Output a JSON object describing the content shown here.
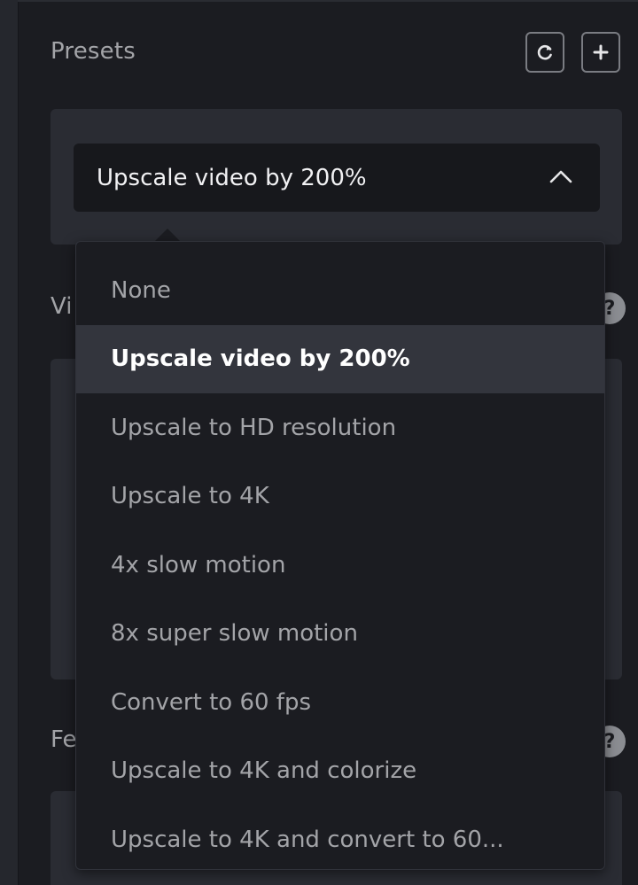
{
  "presets": {
    "title": "Presets",
    "refresh_icon": "refresh-icon",
    "add_icon": "plus-icon",
    "selected_value": "Upscale video by 200%",
    "chevron_icon": "chevron-up-icon",
    "options": [
      {
        "label": "None",
        "selected": false
      },
      {
        "label": "Upscale video by 200%",
        "selected": true
      },
      {
        "label": "Upscale to HD resolution",
        "selected": false
      },
      {
        "label": "Upscale to 4K",
        "selected": false
      },
      {
        "label": "4x slow motion",
        "selected": false
      },
      {
        "label": "8x super slow motion",
        "selected": false
      },
      {
        "label": "Convert to 60 fps",
        "selected": false
      },
      {
        "label": "Upscale to 4K and colorize",
        "selected": false
      },
      {
        "label": "Upscale to 4K and convert to 60..."
      }
    ]
  },
  "background": {
    "video_label_visible": "Vi",
    "features_label_visible": "Fe",
    "help_glyph": "?"
  },
  "colors": {
    "panel_bg": "#1b1c21",
    "card_bg": "#2a2c33",
    "select_bg": "#17181c",
    "selected_item_bg": "#33353d",
    "muted_text": "#a3a4a8",
    "bright_text": "#ffffff"
  }
}
